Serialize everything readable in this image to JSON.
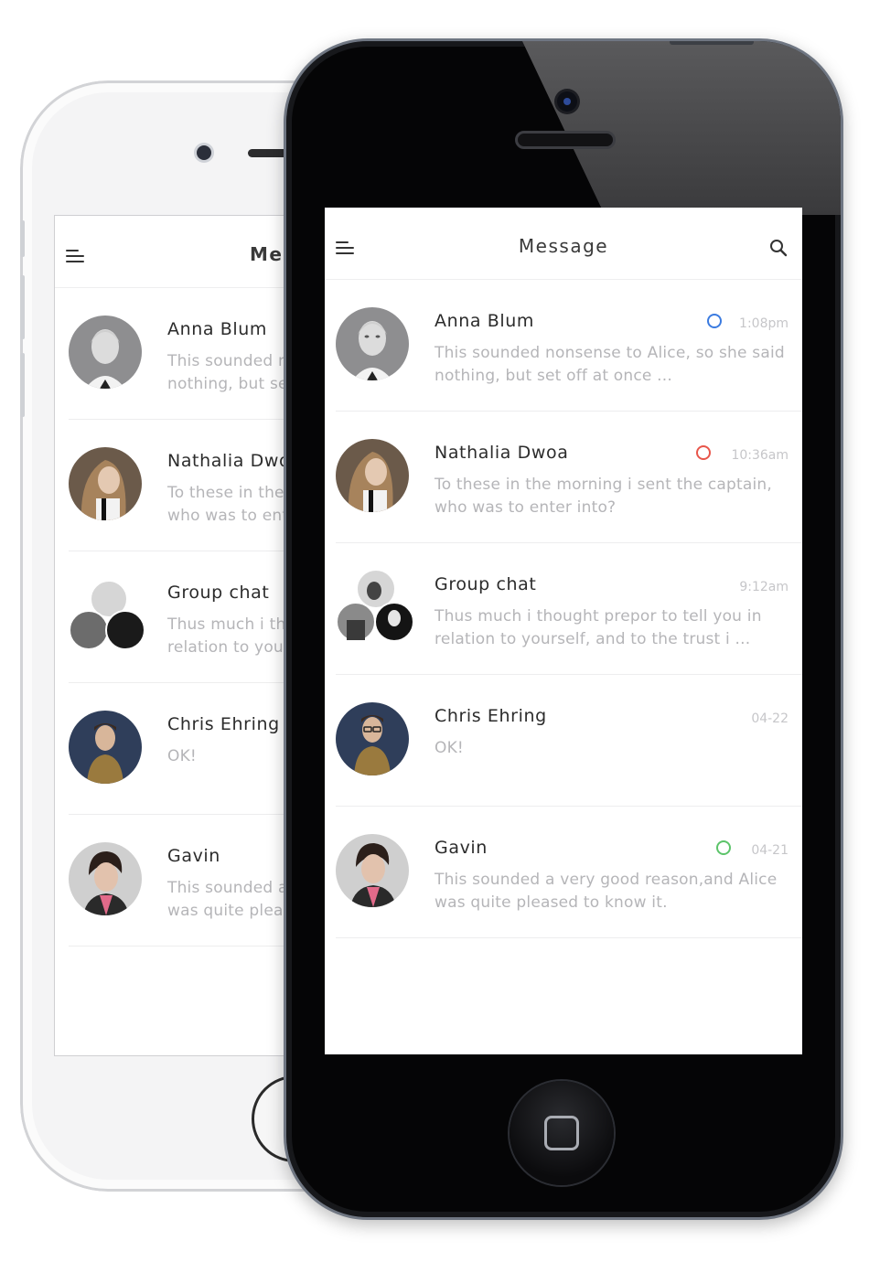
{
  "app": {
    "title": "Message"
  },
  "icons": {
    "menu": "hamburger-menu-icon",
    "search": "search-icon"
  },
  "colors": {
    "unread_blue": "#3b7be0",
    "unread_red": "#e8564b",
    "unread_green": "#5cc46a"
  },
  "conversations": [
    {
      "name": "Anna Blum",
      "preview": "This sounded nonsense to Alice, so she said nothing, but set off at once ...",
      "time": "1:08pm",
      "status": "blue"
    },
    {
      "name": "Nathalia Dwoa",
      "preview": "To these in the morning i sent the captain, who was to enter into?",
      "time": "10:36am",
      "status": "red"
    },
    {
      "name": "Group chat",
      "preview": "Thus much i thought prepor to tell you in relation to yourself, and to the trust i ...",
      "time": "9:12am",
      "status": ""
    },
    {
      "name": "Chris Ehring",
      "preview": "OK!",
      "time": "04-22",
      "status": ""
    },
    {
      "name": "Gavin",
      "preview": "This sounded a very good reason,and Alice was quite pleased to know it.",
      "time": "04-21",
      "status": "green"
    }
  ],
  "back_phone": {
    "title": "Message",
    "conversations": [
      {
        "name": "Anna Blum",
        "preview": "This sounded nonsense to Alice, so she said nothing, but set off at once ..."
      },
      {
        "name": "Nathalia Dwoa",
        "preview": "To these in the morning i sent the captain, who was to enter into?"
      },
      {
        "name": "Group chat",
        "preview": "Thus much i thought prepor to tell you in relation to yourself, and to the trust i ..."
      },
      {
        "name": "Chris Ehring",
        "preview": "OK!"
      },
      {
        "name": "Gavin",
        "preview": "This sounded a very good reason,and Alice was quite pleased to know it."
      }
    ]
  }
}
